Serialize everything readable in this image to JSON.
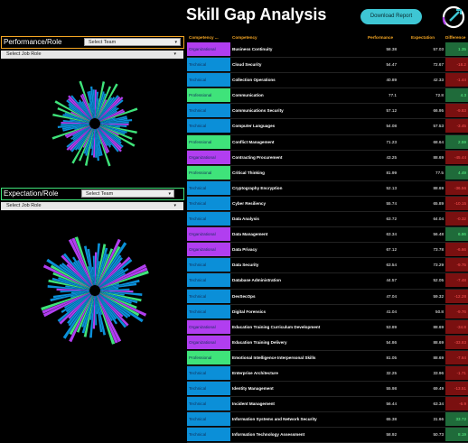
{
  "title": "Skill Gap Analysis",
  "download_label": "Download Report",
  "colors": {
    "technical": "#0b8fd8",
    "organizational": "#b13ef0",
    "professional": "#3fe37a",
    "accent": "#f5a623",
    "positive": "#1f6b3a",
    "negative": "#7a1010"
  },
  "panel1": {
    "label": "Performance/Role",
    "team_select": "Select Team",
    "job_select": "Select Job Role",
    "border": "#f5a623"
  },
  "panel2": {
    "label": "Expectation/Role",
    "team_select": "Select Team",
    "job_select": "Select Job Role",
    "border": "#3fe37a"
  },
  "table": {
    "headers": [
      "Competency ...",
      "Competency",
      "Performance",
      "Expectation",
      "Difference"
    ],
    "rows": [
      {
        "type": "Organizational",
        "name": "Business Continuity",
        "perf": "58.38",
        "exp": "57.03",
        "diff": "1.35"
      },
      {
        "type": "Technical",
        "name": "Cloud Security",
        "perf": "54.47",
        "exp": "72.67",
        "diff": "-18.2"
      },
      {
        "type": "Technical",
        "name": "Collection Operations",
        "perf": "40.89",
        "exp": "42.33",
        "diff": "-1.44"
      },
      {
        "type": "Professional",
        "name": "Communication",
        "perf": "77.1",
        "exp": "72.8",
        "diff": "4.3"
      },
      {
        "type": "Technical",
        "name": "Communications Security",
        "perf": "57.12",
        "exp": "66.95",
        "diff": "-9.83"
      },
      {
        "type": "Technical",
        "name": "Computer Languages",
        "perf": "54.08",
        "exp": "57.53",
        "diff": "-3.45"
      },
      {
        "type": "Professional",
        "name": "Conflict Management",
        "perf": "71.23",
        "exp": "68.64",
        "diff": "2.59"
      },
      {
        "type": "Organizational",
        "name": "Contracting Procurement",
        "perf": "43.25",
        "exp": "88.69",
        "diff": "-45.44"
      },
      {
        "type": "Professional",
        "name": "Critical Thinking",
        "perf": "81.99",
        "exp": "77.5",
        "diff": "4.49"
      },
      {
        "type": "Technical",
        "name": "Cryptography Encryption",
        "perf": "52.13",
        "exp": "88.69",
        "diff": "-36.56"
      },
      {
        "type": "Technical",
        "name": "Cyber Resiliency",
        "perf": "55.74",
        "exp": "65.89",
        "diff": "-10.15"
      },
      {
        "type": "Technical",
        "name": "Data Analysis",
        "perf": "63.72",
        "exp": "64.04",
        "diff": "-0.32"
      },
      {
        "type": "Organizational",
        "name": "Data Management",
        "perf": "63.34",
        "exp": "56.48",
        "diff": "6.86"
      },
      {
        "type": "Organizational",
        "name": "Data Privacy",
        "perf": "67.12",
        "exp": "73.78",
        "diff": "-6.66"
      },
      {
        "type": "Technical",
        "name": "Data Security",
        "perf": "63.54",
        "exp": "73.29",
        "diff": "-9.75"
      },
      {
        "type": "Technical",
        "name": "Database Administration",
        "perf": "44.57",
        "exp": "52.05",
        "diff": "-7.48"
      },
      {
        "type": "Technical",
        "name": "DevSecOps",
        "perf": "47.04",
        "exp": "59.32",
        "diff": "-12.28"
      },
      {
        "type": "Technical",
        "name": "Digital Forensics",
        "perf": "41.04",
        "exp": "50.8",
        "diff": "-9.76"
      },
      {
        "type": "Organizational",
        "name": "Education Training Curriculum Development",
        "perf": "53.89",
        "exp": "88.69",
        "diff": "-34.8"
      },
      {
        "type": "Organizational",
        "name": "Education Training Delivery",
        "perf": "54.86",
        "exp": "88.69",
        "diff": "-33.83"
      },
      {
        "type": "Professional",
        "name": "Emotional Intelligence Interpersonal Skills",
        "perf": "81.05",
        "exp": "88.69",
        "diff": "-7.64"
      },
      {
        "type": "Technical",
        "name": "Enterprise Architecture",
        "perf": "32.25",
        "exp": "33.96",
        "diff": "-1.71"
      },
      {
        "type": "Technical",
        "name": "Identity Management",
        "perf": "55.98",
        "exp": "69.49",
        "diff": "-13.51"
      },
      {
        "type": "Technical",
        "name": "Incident Management",
        "perf": "56.44",
        "exp": "63.34",
        "diff": "-6.9"
      },
      {
        "type": "Technical",
        "name": "Information Systems and Network Security",
        "perf": "65.38",
        "exp": "31.66",
        "diff": "33.72"
      },
      {
        "type": "Technical",
        "name": "Information Technology Assessment",
        "perf": "58.92",
        "exp": "50.73",
        "diff": "8.19"
      }
    ]
  }
}
